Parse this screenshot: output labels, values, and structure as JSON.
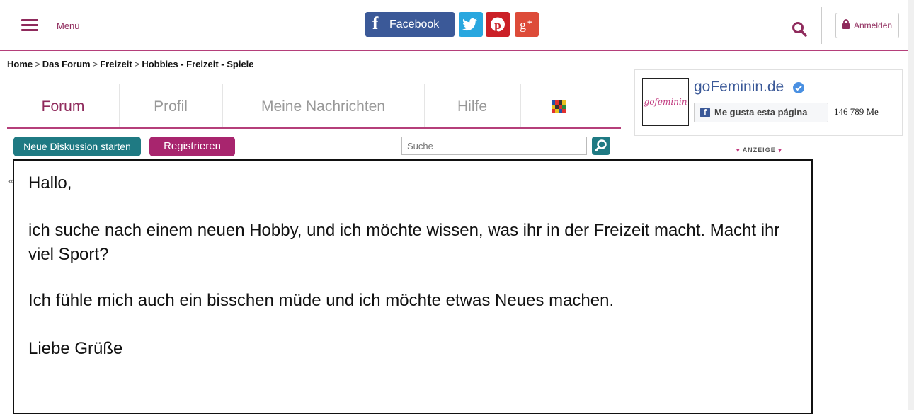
{
  "header": {
    "menu_label": "Menü",
    "facebook_label": "Facebook",
    "login_label": "Anmelden"
  },
  "breadcrumb": [
    "Home",
    "Das Forum",
    "Freizeit",
    "Hobbies - Freizeit - Spiele"
  ],
  "tabs": [
    {
      "label": "Forum",
      "active": true
    },
    {
      "label": "Profil",
      "active": false
    },
    {
      "label": "Meine Nachrichten",
      "active": false
    },
    {
      "label": "Hilfe",
      "active": false
    }
  ],
  "actions": {
    "new_discussion_label": "Neue Diskussion starten",
    "register_label": "Registrieren",
    "search_placeholder": "Suche"
  },
  "sidebar": {
    "page_name": "goFeminin.de",
    "logo_text": "gofeminin",
    "like_label": "Me gusta esta página",
    "like_count": "146 789 Me",
    "ad_label": "ANZEIGE"
  },
  "post": {
    "greeting": "Hallo,",
    "paragraph1": "ich suche nach einem neuen Hobby, und ich möchte wissen, was ihr in der Freizeit macht. Macht ihr viel Sport?",
    "paragraph2": "Ich fühle mich auch ein bisschen müde und ich möchte etwas Neues machen.",
    "closing": "Liebe Grüße"
  },
  "colors": {
    "brand": "#8f2a5c",
    "accent_teal": "#1f7a83",
    "register": "#a8256e",
    "facebook": "#3b5998",
    "twitter": "#29a7df",
    "pinterest": "#cb2027",
    "googleplus": "#dd4b39"
  },
  "icons": [
    "hamburger-icon",
    "facebook-icon",
    "twitter-icon",
    "pinterest-icon",
    "googleplus-icon",
    "search-icon",
    "lock-icon",
    "verified-icon",
    "flag-icon"
  ]
}
